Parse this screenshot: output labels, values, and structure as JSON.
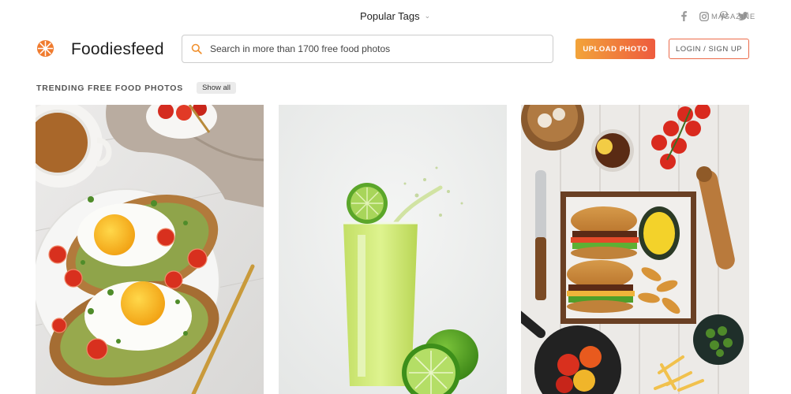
{
  "topbar": {
    "popular_tags_label": "Popular Tags",
    "social_icons": [
      "facebook-icon",
      "instagram-icon",
      "pinterest-icon",
      "twitter-icon"
    ],
    "magazine_label": "MAGAZINE"
  },
  "header": {
    "brand": "Foodiesfeed",
    "search_placeholder": "Search in more than 1700 free food photos",
    "upload_label": "UPLOAD PHOTO",
    "login_label": "LOGIN / SIGN UP"
  },
  "trending": {
    "title": "TRENDING FREE FOOD PHOTOS",
    "show_all_label": "Show all"
  },
  "colors": {
    "accent_start": "#f2a43a",
    "accent_end": "#ee5b3e",
    "logo": "#f07b2e"
  },
  "photos": [
    {
      "subject": "eggs-on-toast-photo"
    },
    {
      "subject": "green-lemonade-photo"
    },
    {
      "subject": "burger-and-fries-photo"
    }
  ]
}
